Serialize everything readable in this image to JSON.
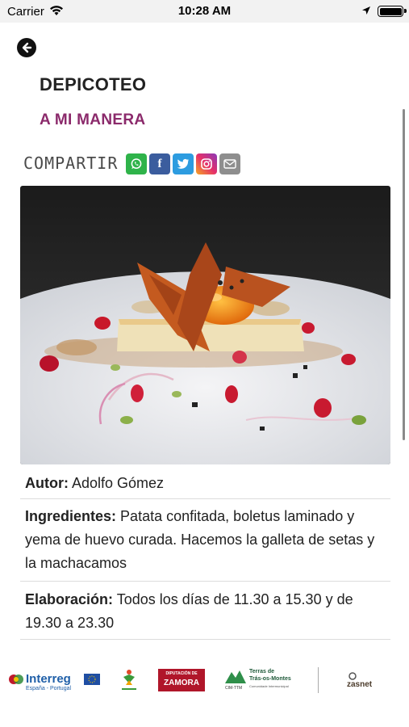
{
  "status_bar": {
    "carrier": "Carrier",
    "time": "10:28 AM"
  },
  "dish": {
    "title": "DEPICOTEO",
    "subtitle": "A MI MANERA"
  },
  "share": {
    "label": "COMPARTIR",
    "buttons": [
      {
        "name": "whatsapp",
        "icon": "whatsapp-icon",
        "color": "#2fb34a"
      },
      {
        "name": "facebook",
        "icon": "facebook-icon",
        "glyph": "f",
        "color": "#3b5d9e"
      },
      {
        "name": "twitter",
        "icon": "twitter-icon",
        "color": "#2d9ce0"
      },
      {
        "name": "instagram",
        "icon": "instagram-icon",
        "color": "#e52f6a"
      },
      {
        "name": "email",
        "icon": "email-icon",
        "color": "#8e8e8e"
      }
    ]
  },
  "info": {
    "author_label": "Autor:",
    "author_value": "Adolfo Gómez",
    "ingredients_label": "Ingredientes:",
    "ingredients_value": "Patata confitada, boletus laminado y yema de huevo curada. Hacemos la galleta de setas y la machacamos",
    "elaboration_label": "Elaboración:",
    "elaboration_value": "Todos los días de 11.30 a 15.30 y de 19.30 a 23.30"
  },
  "footer": {
    "interreg_name": "Interreg",
    "interreg_sub": "España - Portugal",
    "zamora_top": "DIPUTACIÓN DE",
    "zamora_name": "ZAMORA",
    "terras_line1": "Terras de",
    "terras_line2": "Trás-os-Montes",
    "terras_line3": "Comunidade Intermunicipal",
    "terras_abbr": "CIM-TTM",
    "zasnet_name": "zasnet"
  },
  "colors": {
    "accent": "#8b2a6b",
    "status_bar_bg": "#f2f2f2"
  }
}
